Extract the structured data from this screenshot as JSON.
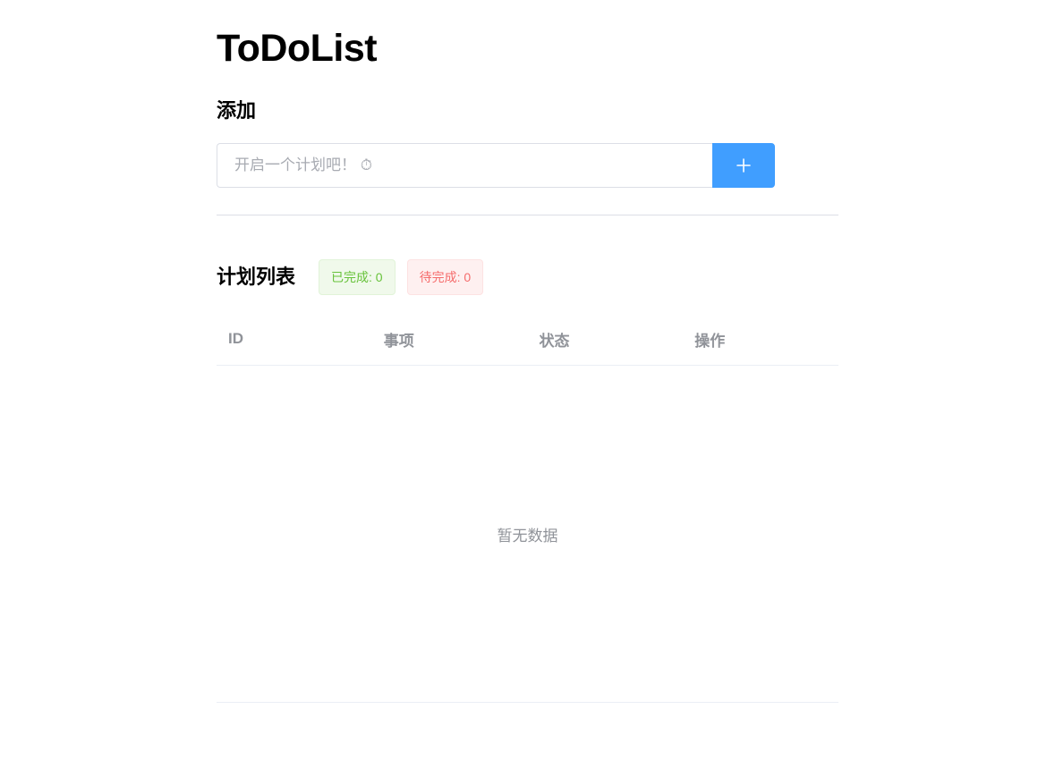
{
  "app": {
    "title": "ToDoList"
  },
  "add_section": {
    "heading": "添加",
    "input_placeholder": "开启一个计划吧！ ⏱",
    "input_value": "",
    "add_button_icon": "plus-icon"
  },
  "list_section": {
    "heading": "计划列表",
    "completed_tag": "已完成: 0",
    "pending_tag": "待完成: 0"
  },
  "table": {
    "columns": [
      "ID",
      "事项",
      "状态",
      "操作"
    ],
    "rows": [],
    "empty_text": "暂无数据"
  },
  "colors": {
    "primary": "#409eff",
    "success": "#67c23a",
    "danger": "#f56c6c",
    "muted": "#909399",
    "border": "#dcdfe6"
  }
}
